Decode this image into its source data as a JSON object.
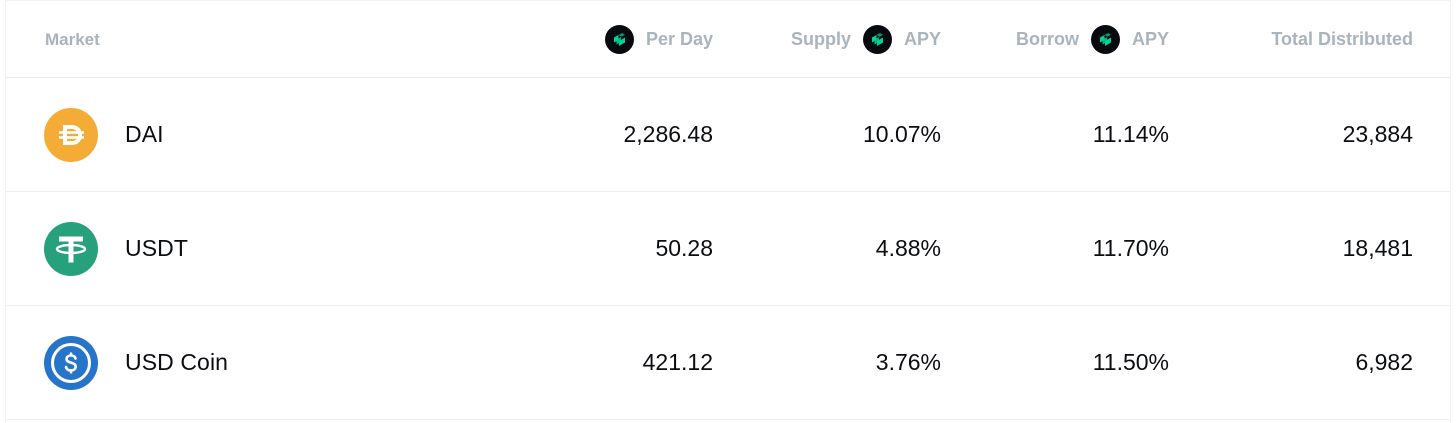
{
  "header": {
    "market": "Market",
    "per_day": "Per Day",
    "supply": "Supply",
    "supply_apy": "APY",
    "borrow": "Borrow",
    "borrow_apy": "APY",
    "total_distributed": "Total Distributed",
    "comp_icon": "comp-token-icon"
  },
  "colors": {
    "header_text": "#aab4bd",
    "body_text": "#0b0d10",
    "comp_bg": "#070a0e",
    "comp_accent": "#00d395",
    "dai": "#f5ac37",
    "usdt": "#26a17b",
    "usdc": "#2775ca"
  },
  "rows": [
    {
      "name": "DAI",
      "icon": "dai-icon",
      "per_day": "2,286.48",
      "supply_apy": "10.07%",
      "borrow_apy": "11.14%",
      "total_distributed": "23,884"
    },
    {
      "name": "USDT",
      "icon": "usdt-icon",
      "per_day": "50.28",
      "supply_apy": "4.88%",
      "borrow_apy": "11.70%",
      "total_distributed": "18,481"
    },
    {
      "name": "USD Coin",
      "icon": "usdc-icon",
      "per_day": "421.12",
      "supply_apy": "3.76%",
      "borrow_apy": "11.50%",
      "total_distributed": "6,982"
    }
  ]
}
